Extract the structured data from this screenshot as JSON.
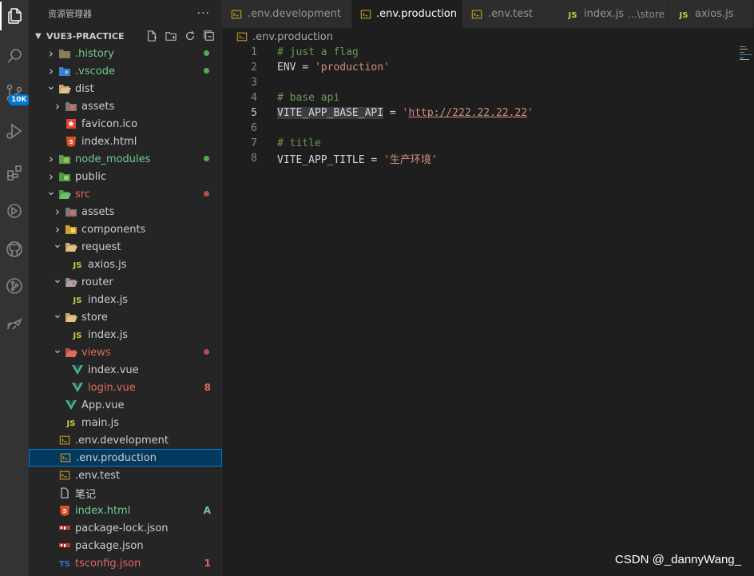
{
  "sidebar": {
    "title": "资源管理器",
    "more": "···",
    "project": "VUE3-PRACTICE",
    "items": [
      {
        "label": ".history",
        "indent": 0,
        "twisty": "right",
        "icon": "folder-history-icon",
        "color": "green",
        "dot": "#4caf50"
      },
      {
        "label": ".vscode",
        "indent": 0,
        "twisty": "right",
        "icon": "folder-vscode-icon",
        "color": "green",
        "dot": "#4caf50"
      },
      {
        "label": "dist",
        "indent": 0,
        "twisty": "down",
        "icon": "folder-dist-open-icon",
        "color": "normal"
      },
      {
        "label": "assets",
        "indent": 1,
        "twisty": "right",
        "icon": "folder-assets-icon",
        "color": "normal"
      },
      {
        "label": "favicon.ico",
        "indent": 1,
        "twisty": "",
        "icon": "favicon-icon",
        "color": "normal"
      },
      {
        "label": "index.html",
        "indent": 1,
        "twisty": "",
        "icon": "html-icon",
        "color": "normal"
      },
      {
        "label": "node_modules",
        "indent": 0,
        "twisty": "right",
        "icon": "folder-node-icon",
        "color": "green",
        "dot": "#4caf50"
      },
      {
        "label": "public",
        "indent": 0,
        "twisty": "right",
        "icon": "folder-public-icon",
        "color": "normal"
      },
      {
        "label": "src",
        "indent": 0,
        "twisty": "down",
        "icon": "folder-src-open-icon",
        "color": "red",
        "dot": "#b05050"
      },
      {
        "label": "assets",
        "indent": 1,
        "twisty": "right",
        "icon": "folder-assets-icon",
        "color": "normal"
      },
      {
        "label": "components",
        "indent": 1,
        "twisty": "right",
        "icon": "folder-components-icon",
        "color": "normal"
      },
      {
        "label": "request",
        "indent": 1,
        "twisty": "down",
        "icon": "folder-request-open-icon",
        "color": "normal"
      },
      {
        "label": "axios.js",
        "indent": 2,
        "twisty": "",
        "icon": "js-icon",
        "color": "normal"
      },
      {
        "label": "router",
        "indent": 1,
        "twisty": "down",
        "icon": "folder-router-open-icon",
        "color": "normal"
      },
      {
        "label": "index.js",
        "indent": 2,
        "twisty": "",
        "icon": "js-icon",
        "color": "normal"
      },
      {
        "label": "store",
        "indent": 1,
        "twisty": "down",
        "icon": "folder-store-open-icon",
        "color": "normal"
      },
      {
        "label": "index.js",
        "indent": 2,
        "twisty": "",
        "icon": "js-icon",
        "color": "normal"
      },
      {
        "label": "views",
        "indent": 1,
        "twisty": "down",
        "icon": "folder-views-open-icon",
        "color": "red",
        "dot": "#b05050"
      },
      {
        "label": "index.vue",
        "indent": 2,
        "twisty": "",
        "icon": "vue-icon",
        "color": "normal"
      },
      {
        "label": "login.vue",
        "indent": 2,
        "twisty": "",
        "icon": "vue-icon",
        "color": "red",
        "badge": "8"
      },
      {
        "label": "App.vue",
        "indent": 1,
        "twisty": "",
        "icon": "vue-icon",
        "color": "normal"
      },
      {
        "label": "main.js",
        "indent": 1,
        "twisty": "",
        "icon": "js-icon",
        "color": "normal"
      },
      {
        "label": ".env.development",
        "indent": 0,
        "twisty": "",
        "icon": "env-icon",
        "color": "normal"
      },
      {
        "label": ".env.production",
        "indent": 0,
        "twisty": "",
        "icon": "env-icon",
        "color": "normal",
        "selected": true
      },
      {
        "label": ".env.test",
        "indent": 0,
        "twisty": "",
        "icon": "env-icon",
        "color": "normal"
      },
      {
        "label": "笔记",
        "indent": 0,
        "twisty": "",
        "icon": "file-icon",
        "color": "normal"
      },
      {
        "label": "index.html",
        "indent": 0,
        "twisty": "",
        "icon": "html-icon",
        "color": "green",
        "badge": "A"
      },
      {
        "label": "package-lock.json",
        "indent": 0,
        "twisty": "",
        "icon": "npm-icon",
        "color": "normal"
      },
      {
        "label": "package.json",
        "indent": 0,
        "twisty": "",
        "icon": "npm-icon",
        "color": "normal"
      },
      {
        "label": "tsconfig.json",
        "indent": 0,
        "twisty": "",
        "icon": "ts-icon",
        "color": "red",
        "badge": "1"
      }
    ]
  },
  "activity": {
    "badge": "10K"
  },
  "tabs": [
    {
      "label": ".env.development",
      "icon": "env-icon",
      "active": false
    },
    {
      "label": ".env.production",
      "icon": "env-icon",
      "active": true,
      "close": "✕"
    },
    {
      "label": ".env.test",
      "icon": "env-icon",
      "active": false
    },
    {
      "label": "index.js",
      "icon": "js-icon",
      "active": false,
      "hint": "...\\store"
    },
    {
      "label": "axios.js",
      "icon": "js-icon",
      "active": false
    }
  ],
  "breadcrumb": ".env.production",
  "editor": {
    "lines": [
      {
        "n": "1",
        "comment": "# just a flag"
      },
      {
        "n": "2",
        "key": "ENV",
        "op": " = ",
        "value": "'production'"
      },
      {
        "n": "3"
      },
      {
        "n": "4",
        "comment": "# base api"
      },
      {
        "n": "5",
        "key": "VITE_APP_BASE_API",
        "op": " = ",
        "q1": "'",
        "url": "http://222.22.22.22",
        "q2": "'",
        "current": true
      },
      {
        "n": "6"
      },
      {
        "n": "7",
        "comment": "# title"
      },
      {
        "n": "8",
        "key": "VITE_APP_TITLE",
        "op": " = ",
        "value": "'生产环境'"
      }
    ]
  },
  "watermark": "CSDN @_dannyWang_",
  "colors": {
    "accent": "#0078d4",
    "git_green": "#73c991",
    "git_red": "#e2675d",
    "comment": "#6a9955",
    "string": "#ce9178"
  }
}
